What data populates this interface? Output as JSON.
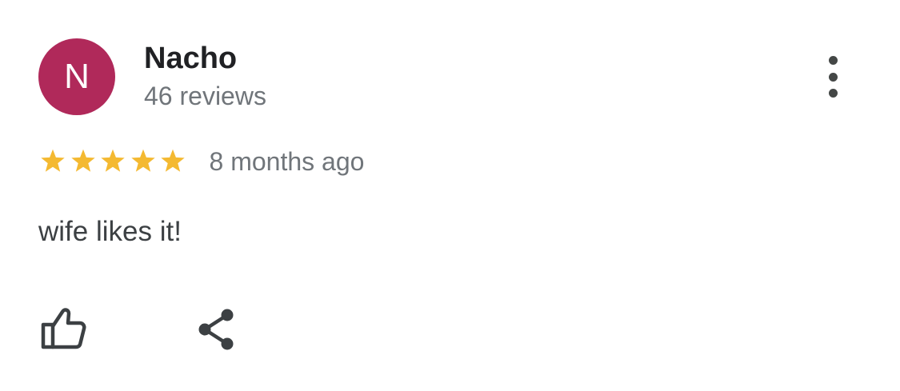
{
  "review": {
    "avatar_letter": "N",
    "avatar_color": "#b0295a",
    "reviewer_name": "Nacho",
    "review_count": "46 reviews",
    "rating": 5,
    "rating_max": 5,
    "star_color": "#f4b931",
    "time_ago": "8 months ago",
    "text": "wife likes it!"
  },
  "actions": {
    "more_icon": "more-vert-icon",
    "like_icon": "thumbs-up-icon",
    "share_icon": "share-icon"
  }
}
